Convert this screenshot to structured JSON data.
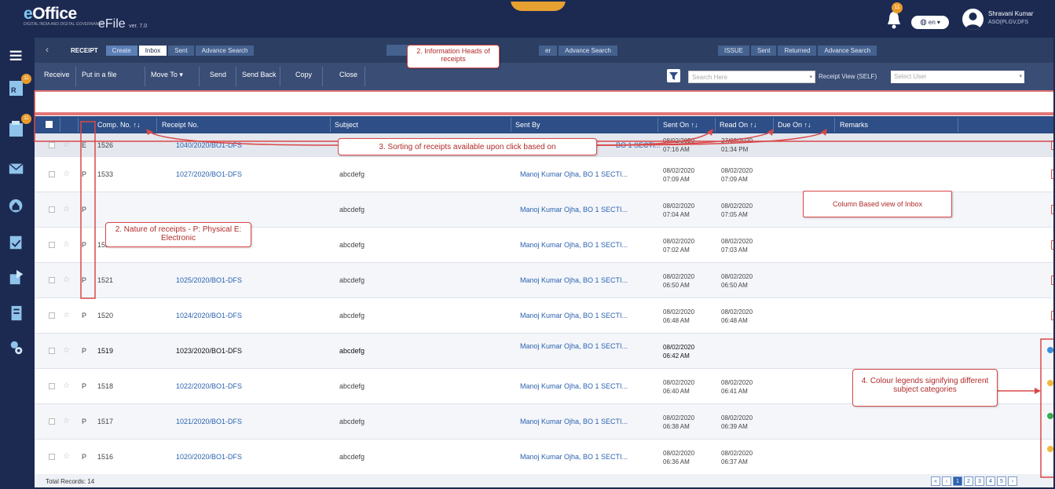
{
  "header": {
    "logo_text": "eOffice",
    "logo_subtext": "DIGITAL INDIA AND DIGITAL GOVERNANCE",
    "app_name": "eFile",
    "app_version": "ver. 7.0",
    "notification_count": "11",
    "language": "en",
    "user_name": "Shravani Kumar",
    "user_designation": "ASO(PLGV,DFS"
  },
  "sidebar": {
    "badges": [
      "11",
      "11"
    ]
  },
  "tabs": {
    "receipt": {
      "title": "RECEIPT",
      "items": [
        "Create",
        "Inbox",
        "Sent",
        "Advance Search"
      ]
    },
    "file": {
      "items": [
        "er",
        "Advance Search"
      ]
    },
    "issue": {
      "title": "ISSUE",
      "items": [
        "Sent",
        "Returned",
        "Advance Search"
      ]
    }
  },
  "toolbar": {
    "buttons": [
      "Receive",
      "Put in a file",
      "Move To",
      "Send",
      "Send Back",
      "Copy",
      "Close"
    ],
    "search_placeholder": "Search Here",
    "receipt_view_label": "Receipt View (SELF)",
    "select_user_placeholder": "Select User"
  },
  "table": {
    "headers": {
      "comp_no": "Comp. No.",
      "receipt_no": "Receipt No.",
      "subject": "Subject",
      "sent_by": "Sent By",
      "sent_on": "Sent On",
      "read_on": "Read On",
      "due_on": "Due On",
      "remarks": "Remarks"
    },
    "rows": [
      {
        "nature": "E",
        "comp_no": "1526",
        "receipt_no": "1040/2020/BO1-DFS",
        "subject": "",
        "sent_by": "BO 1 SECTI...",
        "sent_on_date": "08/02/2020",
        "sent_on_time": "07:16 AM",
        "read_on_date": "27/02/2020",
        "read_on_time": "01:34 PM"
      },
      {
        "nature": "P",
        "comp_no": "1533",
        "receipt_no": "1027/2020/BO1-DFS",
        "subject": "abcdefg",
        "sent_by": "Manoj Kumar Ojha, BO 1 SECTI...",
        "sent_on_date": "08/02/2020",
        "sent_on_time": "07:09 AM",
        "read_on_date": "08/02/2020",
        "read_on_time": "07:09 AM"
      },
      {
        "nature": "P",
        "comp_no": "",
        "receipt_no": "",
        "subject": "abcdefg",
        "sent_by": "Manoj Kumar Ojha, BO 1 SECTI...",
        "sent_on_date": "08/02/2020",
        "sent_on_time": "07:04 AM",
        "read_on_date": "08/02/2020",
        "read_on_time": "07:05 AM"
      },
      {
        "nature": "P",
        "comp_no": "1522",
        "receipt_no": "",
        "subject": "abcdefg",
        "sent_by": "Manoj Kumar Ojha, BO 1 SECTI...",
        "sent_on_date": "08/02/2020",
        "sent_on_time": "07:02 AM",
        "read_on_date": "08/02/2020",
        "read_on_time": "07:03 AM"
      },
      {
        "nature": "P",
        "comp_no": "1521",
        "receipt_no": "1025/2020/BO1-DFS",
        "subject": "abcdefg",
        "sent_by": "Manoj Kumar Ojha, BO 1 SECTI...",
        "sent_on_date": "08/02/2020",
        "sent_on_time": "06:50 AM",
        "read_on_date": "08/02/2020",
        "read_on_time": "06:50 AM"
      },
      {
        "nature": "P",
        "comp_no": "1520",
        "receipt_no": "1024/2020/BO1-DFS",
        "subject": "abcdefg",
        "sent_by": "Manoj Kumar Ojha, BO 1 SECTI...",
        "sent_on_date": "08/02/2020",
        "sent_on_time": "06:48 AM",
        "read_on_date": "08/02/2020",
        "read_on_time": "06:48 AM"
      },
      {
        "nature": "P",
        "comp_no": "1519",
        "receipt_no": "1023/2020/BO1-DFS",
        "subject": "abcdefg",
        "sent_by": "Manoj Kumar Ojha, BO 1 SECTI...",
        "sent_on_date": "08/02/2020",
        "sent_on_time": "06:42 AM",
        "read_on_date": "",
        "read_on_time": ""
      },
      {
        "nature": "P",
        "comp_no": "1518",
        "receipt_no": "1022/2020/BO1-DFS",
        "subject": "abcdefg",
        "sent_by": "Manoj Kumar Ojha, BO 1 SECTI...",
        "sent_on_date": "08/02/2020",
        "sent_on_time": "06:40 AM",
        "read_on_date": "08/02/2020",
        "read_on_time": "06:41 AM"
      },
      {
        "nature": "P",
        "comp_no": "1517",
        "receipt_no": "1021/2020/BO1-DFS",
        "subject": "abcdefg",
        "sent_by": "Manoj Kumar Ojha, BO 1 SECTI...",
        "sent_on_date": "08/02/2020",
        "sent_on_time": "06:38 AM",
        "read_on_date": "08/02/2020",
        "read_on_time": "06:39 AM"
      },
      {
        "nature": "P",
        "comp_no": "1516",
        "receipt_no": "1020/2020/BO1-DFS",
        "subject": "abcdefg",
        "sent_by": "Manoj Kumar Ojha, BO 1 SECTI...",
        "sent_on_date": "08/02/2020",
        "sent_on_time": "06:36 AM",
        "read_on_date": "08/02/2020",
        "read_on_time": "06:37 AM"
      }
    ]
  },
  "footer": {
    "total_records": "Total Records: 14",
    "pages": [
      "1",
      "2",
      "3",
      "4",
      "5"
    ]
  },
  "annotations": {
    "info_heads": "2. Information Heads of receipts",
    "sorting": "3. Sorting of receipts available upon click based on",
    "nature": "2. Nature of receipts - P: Physical   E: Electronic",
    "column_view": "Column Based view of Inbox",
    "colour_legends": "4. Colour legends signifying different subject categories"
  },
  "colors": {
    "header_bg": "#1c2a52",
    "accent_orange": "#e99a2a",
    "table_header_bg": "#2d4e87",
    "link_blue": "#2b62b0",
    "annotation_red": "#d94848",
    "legend_colors": [
      "#3b8fd8",
      "#f0b93a",
      "#3ba853",
      "#f0b93a"
    ]
  }
}
